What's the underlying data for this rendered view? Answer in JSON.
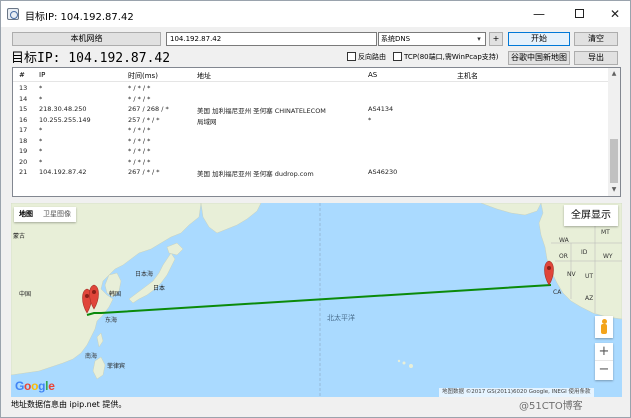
{
  "window": {
    "title": "目标IP: 104.192.87.42"
  },
  "toolbar": {
    "local_network_label": "本机网络",
    "ip_value": "104.192.87.42",
    "dns_selected": "系统DNS",
    "plus_label": "+",
    "start_label": "开始",
    "clear_label": "清空"
  },
  "options": {
    "target_label": "目标IP: 104.192.87.42",
    "reverse_route_label": "反向路由",
    "tcp_label": "TCP(80端口,需WinPcap支持)",
    "google_map_label": "谷歌中国新地图",
    "export_label": "导出"
  },
  "table": {
    "headers": {
      "num": "#",
      "ip": "IP",
      "time": "时间(ms)",
      "addr": "地址",
      "as": "AS",
      "host": "主机名"
    },
    "rows": [
      {
        "num": "13",
        "ip": "*",
        "time": "* / * / *",
        "addr": "",
        "as": "",
        "host": ""
      },
      {
        "num": "14",
        "ip": "*",
        "time": "* / * / *",
        "addr": "",
        "as": "",
        "host": ""
      },
      {
        "num": "15",
        "ip": "218.30.48.250",
        "time": "267 / 268 / *",
        "addr": "美国 加利福尼亚州 圣何塞 CHINATELECOM",
        "as": "AS4134",
        "host": ""
      },
      {
        "num": "16",
        "ip": "10.255.255.149",
        "time": "257 / * / *",
        "addr": "局域网",
        "as": "*",
        "host": ""
      },
      {
        "num": "17",
        "ip": "*",
        "time": "* / * / *",
        "addr": "",
        "as": "",
        "host": ""
      },
      {
        "num": "18",
        "ip": "*",
        "time": "* / * / *",
        "addr": "",
        "as": "",
        "host": ""
      },
      {
        "num": "19",
        "ip": "*",
        "time": "* / * / *",
        "addr": "",
        "as": "",
        "host": ""
      },
      {
        "num": "20",
        "ip": "*",
        "time": "* / * / *",
        "addr": "",
        "as": "",
        "host": ""
      },
      {
        "num": "21",
        "ip": "104.192.87.42",
        "time": "267 / * / *",
        "addr": "美国 加利福尼亚州 圣何塞 dudrop.com",
        "as": "AS46230",
        "host": ""
      }
    ]
  },
  "map": {
    "type_map": "地图",
    "type_satellite": "卫星图像",
    "fullscreen_label": "全屏显示",
    "zoom_in": "+",
    "zoom_out": "−",
    "attribution": "地图数据 ©2017 GS(2011)6020 Google, INEGI   使用条款",
    "labels": {
      "mongolia": "蒙古",
      "china": "中国",
      "korea": "韩国",
      "japan": "日本",
      "sea_of_japan": "日本海",
      "east_china_sea": "东海",
      "south_china_sea": "南海",
      "philippines": "菲律宾",
      "north_pacific": "北太平洋",
      "wa": "WA",
      "or": "OR",
      "id": "ID",
      "nv": "NV",
      "ca": "CA",
      "ut": "UT",
      "az": "AZ",
      "mt": "MT",
      "wy": "WY"
    },
    "google_logo": [
      "G",
      "o",
      "o",
      "g",
      "l",
      "e"
    ],
    "route_color": "#0a8a0a",
    "marker_color": "#e0453a"
  },
  "status": {
    "text": "地址数据信息由 ipip.net 提供。",
    "watermark": "@51CTO博客"
  }
}
